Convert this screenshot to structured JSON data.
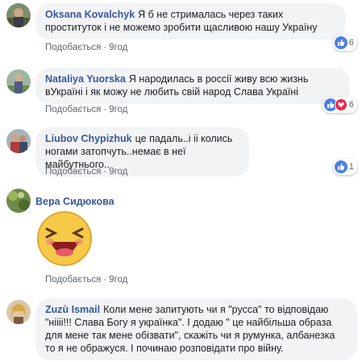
{
  "comments": [
    {
      "author": "Oksana Kovalchyk",
      "text": "Я б не стрималась через таких проституток і не можемо зробити щасливою нашу Україну",
      "like_label": "Подобається",
      "time": "9год",
      "reaction_count": "6"
    },
    {
      "author": "Nataliya Yuorska",
      "text": "Я народилась в россії живу всю жизнь вУкраїні і як можу не любить свій народ Слава Україні",
      "like_label": "Подобається",
      "time": "9год",
      "reaction_count": "6"
    },
    {
      "author": "Liubov Chypizhuk",
      "text": "це падаль..і іі колись ногами затопчуть..немає в неї майбутнього..",
      "like_label": "Подобається",
      "time": "9год",
      "reaction_count": "1"
    },
    {
      "author": "Вера Сидюкова",
      "text": "",
      "like_label": "Подобається",
      "time": "9год",
      "reaction_count": ""
    },
    {
      "author": "Zuzù Ismail",
      "text": "Коли мене запитують чи я \"русса\" то відповідаю \"ніііі!!! Слава Богу я українка\". І додаю \" це найбільша образа для мене так мене обізвати\", скажіть чи я румунка, албанезка то я не ображуся. І починаю розповідати про війну.",
      "like_label": "",
      "time": "",
      "reaction_count": ""
    }
  ],
  "separator": "·"
}
